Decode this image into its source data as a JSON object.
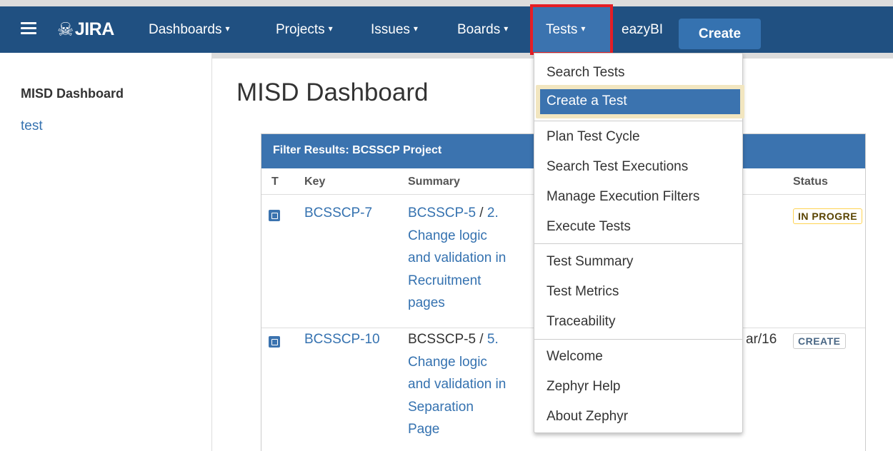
{
  "nav": {
    "logo": "JIRA",
    "items": [
      {
        "label": "Dashboards",
        "caret": "▾"
      },
      {
        "label": "Projects",
        "caret": "▾"
      },
      {
        "label": "Issues",
        "caret": "▾"
      },
      {
        "label": "Boards",
        "caret": "▾"
      },
      {
        "label": "Tests",
        "caret": "▾"
      },
      {
        "label": "eazyBI"
      }
    ],
    "create_label": "Create"
  },
  "sidebar": {
    "title": "MISD Dashboard",
    "link": "test"
  },
  "main": {
    "page_title": "MISD Dashboard",
    "gadget": {
      "header": "Filter Results: BCSSCP Project",
      "columns": {
        "type": "T",
        "key": "Key",
        "summary": "Summary",
        "status": "Status"
      },
      "rows": [
        {
          "key": "BCSSCP-7",
          "summary_parent": "BCSSCP-5",
          "summary_sep": " / ",
          "summary_lines": [
            "2.",
            "Change logic",
            "and validation in",
            "Recruitment",
            "pages"
          ],
          "updated": "",
          "status": "IN PROGRE"
        },
        {
          "key": "BCSSCP-10",
          "summary_parent": "BCSSCP-5",
          "summary_sep": " / ",
          "summary_lines": [
            "5.",
            "Change logic",
            "and validation in",
            "Separation",
            "Page"
          ],
          "updated": "ar/16",
          "status": "CREATE"
        }
      ]
    }
  },
  "dropdown": {
    "groups": [
      [
        "Search Tests",
        "Create a Test"
      ],
      [
        "Plan Test Cycle",
        "Search Test Executions",
        "Manage Execution Filters",
        "Execute Tests"
      ],
      [
        "Test Summary",
        "Test Metrics",
        "Traceability"
      ],
      [
        "Welcome",
        "Zephyr Help",
        "About Zephyr"
      ]
    ]
  },
  "colors": {
    "navbar": "#205081",
    "active_tab": "#3b73af",
    "highlight_frame": "#e51e25",
    "link": "#3572b0",
    "selected_item": "#3b73af"
  }
}
